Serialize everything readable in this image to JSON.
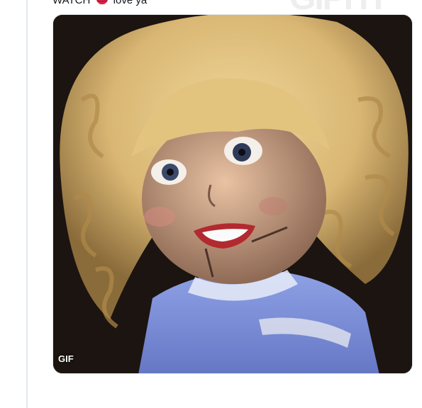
{
  "tweet": {
    "text_before": "WATCH",
    "emoji_icon": "lips-icon",
    "text_after": "love ya"
  },
  "watermark": {
    "text": "GIPHY"
  },
  "media": {
    "badge": "GIF",
    "alt": "Ventriloquist doll with curly blonde hair and blue dress",
    "colors": {
      "hair": "#d9b673",
      "dress": "#7a8fd6",
      "background": "#1c1410"
    }
  }
}
